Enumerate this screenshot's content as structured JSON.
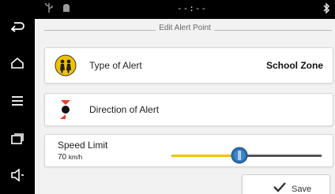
{
  "status": {
    "clock": "--:--"
  },
  "header": {
    "title": "Edit Alert Point"
  },
  "alert_type": {
    "label": "Type of Alert",
    "value": "School Zone",
    "icon": "school-zone-icon"
  },
  "direction": {
    "label": "Direction of Alert",
    "icon": "direction-icon"
  },
  "speed": {
    "label": "Speed Limit",
    "value": "70",
    "unit": "km/h",
    "slider_fraction": 0.45
  },
  "actions": {
    "save_label": "Save"
  },
  "colors": {
    "accent_yellow": "#f2c200",
    "accent_blue": "#2c6fb0",
    "direction_red": "#e04030",
    "check_green": "#333333"
  }
}
